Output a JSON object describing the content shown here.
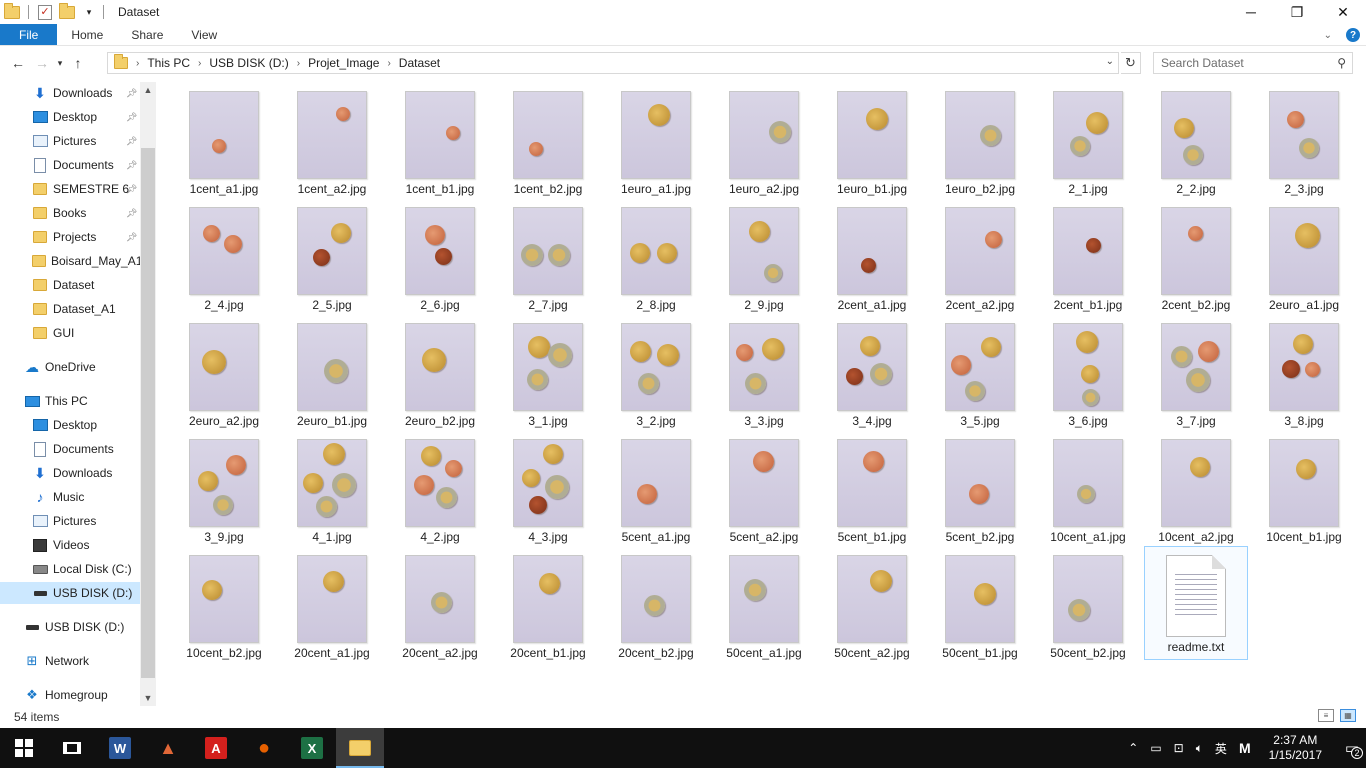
{
  "window": {
    "title": "Dataset",
    "controls": {
      "minimize": "─",
      "maximize": "❐",
      "close": "✕"
    }
  },
  "ribbon": {
    "tabs": [
      "File",
      "Home",
      "Share",
      "View"
    ],
    "expand_icon": "chevron-down-icon",
    "help_label": "?"
  },
  "address": {
    "crumbs": [
      "This PC",
      "USB DISK (D:)",
      "Projet_Image",
      "Dataset"
    ],
    "search_placeholder": "Search Dataset"
  },
  "sidebar": {
    "items": [
      {
        "label": "Downloads",
        "icon": "download-icon",
        "pinned": true,
        "indent": 1,
        "selected": false
      },
      {
        "label": "Desktop",
        "icon": "desktop-icon",
        "pinned": true,
        "indent": 1,
        "selected": false
      },
      {
        "label": "Pictures",
        "icon": "pictures-icon",
        "pinned": true,
        "indent": 1,
        "selected": false
      },
      {
        "label": "Documents",
        "icon": "documents-icon",
        "pinned": true,
        "indent": 1,
        "selected": false
      },
      {
        "label": "SEMESTRE 6",
        "icon": "folder-icon",
        "pinned": true,
        "indent": 1,
        "selected": false
      },
      {
        "label": "Books",
        "icon": "folder-icon",
        "pinned": true,
        "indent": 1,
        "selected": false
      },
      {
        "label": "Projects",
        "icon": "folder-icon",
        "pinned": true,
        "indent": 1,
        "selected": false
      },
      {
        "label": "Boisard_May_A1",
        "icon": "folder-icon",
        "pinned": false,
        "indent": 1,
        "selected": false
      },
      {
        "label": "Dataset",
        "icon": "folder-icon",
        "pinned": false,
        "indent": 1,
        "selected": false
      },
      {
        "label": "Dataset_A1",
        "icon": "folder-icon",
        "pinned": false,
        "indent": 1,
        "selected": false
      },
      {
        "label": "GUI",
        "icon": "folder-icon",
        "pinned": false,
        "indent": 1,
        "selected": false
      },
      {
        "label": "OneDrive",
        "icon": "onedrive-icon",
        "pinned": false,
        "indent": 0,
        "selected": false,
        "gap": true
      },
      {
        "label": "This PC",
        "icon": "this-pc-icon",
        "pinned": false,
        "indent": 0,
        "selected": false,
        "gap": true
      },
      {
        "label": "Desktop",
        "icon": "desktop-icon",
        "pinned": false,
        "indent": 1,
        "selected": false
      },
      {
        "label": "Documents",
        "icon": "documents-icon",
        "pinned": false,
        "indent": 1,
        "selected": false
      },
      {
        "label": "Downloads",
        "icon": "download-icon",
        "pinned": false,
        "indent": 1,
        "selected": false
      },
      {
        "label": "Music",
        "icon": "music-icon",
        "pinned": false,
        "indent": 1,
        "selected": false
      },
      {
        "label": "Pictures",
        "icon": "pictures-icon",
        "pinned": false,
        "indent": 1,
        "selected": false
      },
      {
        "label": "Videos",
        "icon": "videos-icon",
        "pinned": false,
        "indent": 1,
        "selected": false
      },
      {
        "label": "Local Disk (C:)",
        "icon": "local-disk-icon",
        "pinned": false,
        "indent": 1,
        "selected": false
      },
      {
        "label": "USB DISK (D:)",
        "icon": "usb-disk-icon",
        "pinned": false,
        "indent": 1,
        "selected": true
      },
      {
        "label": "USB DISK (D:)",
        "icon": "usb-disk-icon",
        "pinned": false,
        "indent": 0,
        "selected": false,
        "gap": true
      },
      {
        "label": "Network",
        "icon": "network-icon",
        "pinned": false,
        "indent": 0,
        "selected": false,
        "gap": true
      },
      {
        "label": "Homegroup",
        "icon": "homegroup-icon",
        "pinned": false,
        "indent": 0,
        "selected": false,
        "gap": true
      }
    ]
  },
  "files": [
    {
      "name": "1cent_a1.jpg",
      "coins": [
        [
          0.35,
          0.6,
          "c",
          1
        ]
      ]
    },
    {
      "name": "1cent_a2.jpg",
      "coins": [
        [
          0.58,
          0.24,
          "c",
          1
        ]
      ]
    },
    {
      "name": "1cent_b1.jpg",
      "coins": [
        [
          0.62,
          0.46,
          "c",
          1
        ]
      ]
    },
    {
      "name": "1cent_b2.jpg",
      "coins": [
        [
          0.25,
          0.63,
          "c",
          1
        ]
      ]
    },
    {
      "name": "1euro_a1.jpg",
      "coins": [
        [
          0.47,
          0.25,
          "g",
          1.6
        ]
      ]
    },
    {
      "name": "1euro_a2.jpg",
      "coins": [
        [
          0.65,
          0.44,
          "e",
          1.6
        ]
      ]
    },
    {
      "name": "1euro_b1.jpg",
      "coins": [
        [
          0.5,
          0.3,
          "g",
          1.6
        ]
      ]
    },
    {
      "name": "1euro_b2.jpg",
      "coins": [
        [
          0.58,
          0.48,
          "e",
          1.5
        ]
      ]
    },
    {
      "name": "2_1.jpg",
      "coins": [
        [
          0.55,
          0.35,
          "g",
          1.6
        ],
        [
          0.32,
          0.6,
          "e",
          1.4
        ]
      ]
    },
    {
      "name": "2_2.jpg",
      "coins": [
        [
          0.25,
          0.4,
          "g",
          1.4
        ],
        [
          0.38,
          0.7,
          "e",
          1.4
        ]
      ]
    },
    {
      "name": "2_3.jpg",
      "coins": [
        [
          0.3,
          0.3,
          "c",
          1.2
        ],
        [
          0.5,
          0.62,
          "e",
          1.4
        ]
      ]
    },
    {
      "name": "2_4.jpg",
      "coins": [
        [
          0.25,
          0.28,
          "c",
          1.2
        ],
        [
          0.55,
          0.4,
          "c",
          1.3
        ]
      ]
    },
    {
      "name": "2_5.jpg",
      "coins": [
        [
          0.55,
          0.28,
          "g",
          1.4
        ],
        [
          0.28,
          0.55,
          "b",
          1.2
        ]
      ]
    },
    {
      "name": "2_6.jpg",
      "coins": [
        [
          0.35,
          0.3,
          "c",
          1.4
        ],
        [
          0.48,
          0.54,
          "b",
          1.2
        ]
      ]
    },
    {
      "name": "2_7.jpg",
      "coins": [
        [
          0.2,
          0.52,
          "e",
          1.6
        ],
        [
          0.58,
          0.52,
          "e",
          1.6
        ]
      ]
    },
    {
      "name": "2_8.jpg",
      "coins": [
        [
          0.2,
          0.5,
          "g",
          1.4
        ],
        [
          0.58,
          0.5,
          "g",
          1.4
        ]
      ]
    },
    {
      "name": "2_9.jpg",
      "coins": [
        [
          0.36,
          0.26,
          "g",
          1.5
        ],
        [
          0.55,
          0.72,
          "e",
          1.3
        ]
      ]
    },
    {
      "name": "2cent_a1.jpg",
      "coins": [
        [
          0.38,
          0.64,
          "b",
          1.1
        ]
      ]
    },
    {
      "name": "2cent_a2.jpg",
      "coins": [
        [
          0.62,
          0.35,
          "c",
          1.2
        ]
      ]
    },
    {
      "name": "2cent_b1.jpg",
      "coins": [
        [
          0.5,
          0.42,
          "b",
          1.1
        ]
      ]
    },
    {
      "name": "2cent_b2.jpg",
      "coins": [
        [
          0.42,
          0.28,
          "c",
          1.1
        ]
      ]
    },
    {
      "name": "2euro_a1.jpg",
      "coins": [
        [
          0.48,
          0.3,
          "g",
          1.8
        ]
      ]
    },
    {
      "name": "2euro_a2.jpg",
      "coins": [
        [
          0.28,
          0.42,
          "g",
          1.7
        ]
      ]
    },
    {
      "name": "2euro_b1.jpg",
      "coins": [
        [
          0.48,
          0.52,
          "e",
          1.7
        ]
      ]
    },
    {
      "name": "2euro_b2.jpg",
      "coins": [
        [
          0.34,
          0.4,
          "g",
          1.7
        ]
      ]
    },
    {
      "name": "3_1.jpg",
      "coins": [
        [
          0.3,
          0.25,
          "g",
          1.6
        ],
        [
          0.6,
          0.35,
          "e",
          1.7
        ],
        [
          0.28,
          0.62,
          "e",
          1.5
        ]
      ]
    },
    {
      "name": "3_2.jpg",
      "coins": [
        [
          0.2,
          0.3,
          "g",
          1.5
        ],
        [
          0.6,
          0.35,
          "g",
          1.6
        ],
        [
          0.32,
          0.66,
          "e",
          1.5
        ]
      ]
    },
    {
      "name": "3_3.jpg",
      "coins": [
        [
          0.15,
          0.32,
          "c",
          1.2
        ],
        [
          0.55,
          0.28,
          "g",
          1.6
        ],
        [
          0.3,
          0.66,
          "e",
          1.5
        ]
      ]
    },
    {
      "name": "3_4.jpg",
      "coins": [
        [
          0.4,
          0.24,
          "g",
          1.4
        ],
        [
          0.18,
          0.58,
          "b",
          1.2
        ],
        [
          0.55,
          0.55,
          "e",
          1.6
        ]
      ]
    },
    {
      "name": "3_5.jpg",
      "coins": [
        [
          0.58,
          0.26,
          "g",
          1.4
        ],
        [
          0.15,
          0.45,
          "c",
          1.4
        ],
        [
          0.36,
          0.74,
          "e",
          1.4
        ]
      ]
    },
    {
      "name": "3_6.jpg",
      "coins": [
        [
          0.42,
          0.2,
          "g",
          1.6
        ],
        [
          0.45,
          0.55,
          "g",
          1.3
        ],
        [
          0.46,
          0.82,
          "e",
          1.2
        ]
      ]
    },
    {
      "name": "3_7.jpg",
      "coins": [
        [
          0.22,
          0.36,
          "e",
          1.5
        ],
        [
          0.6,
          0.3,
          "c",
          1.5
        ],
        [
          0.45,
          0.62,
          "e",
          1.7
        ]
      ]
    },
    {
      "name": "3_8.jpg",
      "coins": [
        [
          0.42,
          0.22,
          "g",
          1.4
        ],
        [
          0.24,
          0.5,
          "b",
          1.3
        ],
        [
          0.55,
          0.5,
          "c",
          1.1
        ]
      ]
    },
    {
      "name": "3_9.jpg",
      "coins": [
        [
          0.6,
          0.28,
          "c",
          1.4
        ],
        [
          0.2,
          0.46,
          "g",
          1.4
        ],
        [
          0.42,
          0.72,
          "e",
          1.4
        ]
      ]
    },
    {
      "name": "4_1.jpg",
      "coins": [
        [
          0.45,
          0.16,
          "g",
          1.6
        ],
        [
          0.15,
          0.48,
          "g",
          1.4
        ],
        [
          0.6,
          0.5,
          "e",
          1.7
        ],
        [
          0.35,
          0.74,
          "e",
          1.5
        ]
      ]
    },
    {
      "name": "4_2.jpg",
      "coins": [
        [
          0.3,
          0.18,
          "g",
          1.4
        ],
        [
          0.62,
          0.32,
          "c",
          1.2
        ],
        [
          0.2,
          0.5,
          "c",
          1.4
        ],
        [
          0.52,
          0.64,
          "e",
          1.5
        ]
      ]
    },
    {
      "name": "4_3.jpg",
      "coins": [
        [
          0.5,
          0.16,
          "g",
          1.4
        ],
        [
          0.18,
          0.42,
          "g",
          1.3
        ],
        [
          0.55,
          0.52,
          "e",
          1.7
        ],
        [
          0.28,
          0.72,
          "b",
          1.3
        ]
      ]
    },
    {
      "name": "5cent_a1.jpg",
      "coins": [
        [
          0.3,
          0.6,
          "c",
          1.4
        ]
      ]
    },
    {
      "name": "5cent_a2.jpg",
      "coins": [
        [
          0.42,
          0.24,
          "c",
          1.5
        ]
      ]
    },
    {
      "name": "5cent_b1.jpg",
      "coins": [
        [
          0.45,
          0.24,
          "c",
          1.5
        ]
      ]
    },
    {
      "name": "5cent_b2.jpg",
      "coins": [
        [
          0.42,
          0.6,
          "c",
          1.4
        ]
      ]
    },
    {
      "name": "10cent_a1.jpg",
      "coins": [
        [
          0.4,
          0.6,
          "e",
          1.3
        ]
      ]
    },
    {
      "name": "10cent_a2.jpg",
      "coins": [
        [
          0.48,
          0.3,
          "g",
          1.4
        ]
      ]
    },
    {
      "name": "10cent_b1.jpg",
      "coins": [
        [
          0.46,
          0.32,
          "g",
          1.4
        ]
      ]
    },
    {
      "name": "10cent_b2.jpg",
      "coins": [
        [
          0.25,
          0.38,
          "g",
          1.4
        ]
      ]
    },
    {
      "name": "20cent_a1.jpg",
      "coins": [
        [
          0.45,
          0.28,
          "g",
          1.5
        ]
      ]
    },
    {
      "name": "20cent_a2.jpg",
      "coins": [
        [
          0.45,
          0.52,
          "e",
          1.5
        ]
      ]
    },
    {
      "name": "20cent_b1.jpg",
      "coins": [
        [
          0.45,
          0.3,
          "g",
          1.5
        ]
      ]
    },
    {
      "name": "20cent_b2.jpg",
      "coins": [
        [
          0.4,
          0.55,
          "e",
          1.5
        ]
      ]
    },
    {
      "name": "50cent_a1.jpg",
      "coins": [
        [
          0.3,
          0.38,
          "e",
          1.6
        ]
      ]
    },
    {
      "name": "50cent_a2.jpg",
      "coins": [
        [
          0.56,
          0.28,
          "g",
          1.6
        ]
      ]
    },
    {
      "name": "50cent_b1.jpg",
      "coins": [
        [
          0.5,
          0.42,
          "g",
          1.6
        ]
      ]
    },
    {
      "name": "50cent_b2.jpg",
      "coins": [
        [
          0.3,
          0.6,
          "e",
          1.6
        ]
      ]
    },
    {
      "name": "readme.txt",
      "type": "text"
    }
  ],
  "status": {
    "item_count": "54 items"
  },
  "taskbar": {
    "apps": [
      {
        "name": "word",
        "label": "W",
        "color": "#2b579a"
      },
      {
        "name": "matlab",
        "label": "▲",
        "color": "#e16737"
      },
      {
        "name": "acrobat",
        "label": "A",
        "color": "#d4201d"
      },
      {
        "name": "firefox",
        "label": "●",
        "color": "#e66000"
      },
      {
        "name": "excel",
        "label": "X",
        "color": "#1d7044"
      },
      {
        "name": "file-explorer",
        "label": "",
        "color": "#f3cf6a"
      }
    ],
    "tray": {
      "ime": "英",
      "ime2": "M",
      "time": "2:37 AM",
      "date": "1/15/2017",
      "notifications": "2"
    }
  }
}
